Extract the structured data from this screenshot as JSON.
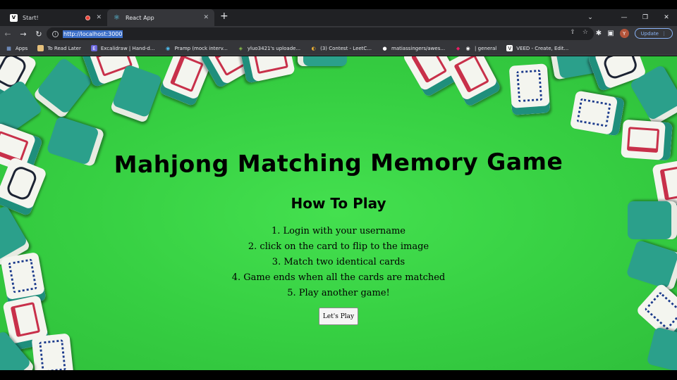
{
  "tabs": [
    {
      "favicon": "V",
      "title": "Start!",
      "recording": true
    },
    {
      "favicon": "react-icon",
      "title": "React App",
      "recording": false
    }
  ],
  "toolbar": {
    "url": "http://localhost:3000",
    "update_label": "Update",
    "avatar_letter": "Y"
  },
  "bookmarks": [
    {
      "icon": "apps-grid-icon",
      "label": "Apps"
    },
    {
      "icon": "folder-icon",
      "label": "To Read Later"
    },
    {
      "icon": "excalidraw-icon",
      "label": "Excalidraw | Hand-d..."
    },
    {
      "icon": "pramp-icon",
      "label": "Pramp (mock interv..."
    },
    {
      "icon": "github-icon",
      "label": "yluo3421's uploade..."
    },
    {
      "icon": "leetcode-icon",
      "label": "(3) Contest - LeetC..."
    },
    {
      "icon": "github-icon",
      "label": "matiassingers/awes..."
    },
    {
      "icon": "discord-icon",
      "label": "| general"
    },
    {
      "icon": "veed-icon",
      "label": "VEED - Create, Edit..."
    }
  ],
  "page": {
    "title": "Mahjong Matching Memory Game",
    "subtitle": "How To Play",
    "steps": [
      "1. Login with your username",
      "2. click on the card to flip to the image",
      "3. Match two identical cards",
      "4. Game ends when all the cards are matched",
      "5. Play another game!"
    ],
    "play_button": "Let's Play"
  },
  "colors": {
    "background_green": "#3ad545",
    "tile_teal": "#2ba08b",
    "tab_bar": "#202124",
    "accent_blue": "#8ab4f8"
  }
}
